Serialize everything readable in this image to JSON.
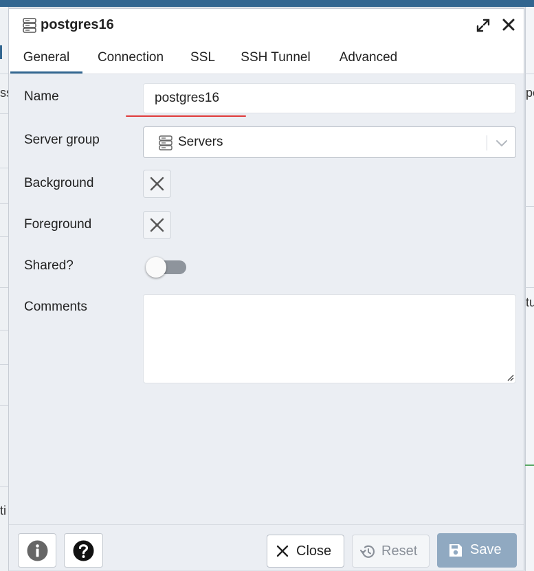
{
  "dialog": {
    "title": "postgres16",
    "tabs": [
      {
        "label": "General",
        "active": true
      },
      {
        "label": "Connection",
        "active": false
      },
      {
        "label": "SSL",
        "active": false
      },
      {
        "label": "SSH Tunnel",
        "active": false
      },
      {
        "label": "Advanced",
        "active": false
      }
    ]
  },
  "form": {
    "name_label": "Name",
    "name_value": "postgres16",
    "server_group_label": "Server group",
    "server_group_value": "Servers",
    "background_label": "Background",
    "foreground_label": "Foreground",
    "shared_label": "Shared?",
    "shared_on": false,
    "comments_label": "Comments",
    "comments_value": ""
  },
  "footer": {
    "close_label": "Close",
    "reset_label": "Reset",
    "save_label": "Save"
  },
  "background_fragments": {
    "left_top": "ss",
    "left_bottom": "ti",
    "right_top": "pe",
    "right_mid": "tu"
  },
  "colors": {
    "accent": "#326690",
    "save_button": "#90a9c1",
    "toggle_off": "#8e949c",
    "spellcheck": "#e03a3a"
  },
  "icons": {
    "title": "server-icon",
    "expand": "expand-icon",
    "close": "close-icon",
    "info": "info-icon",
    "help": "help-icon",
    "reset": "reset-icon",
    "save": "floppy-disk-icon"
  }
}
